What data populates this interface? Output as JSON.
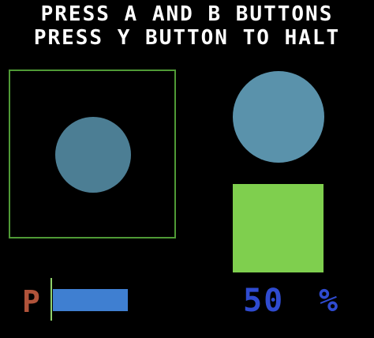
{
  "instructions": {
    "line1": "PRESS A AND B BUTTONS",
    "line2": "PRESS Y BUTTON TO HALT"
  },
  "shapes": {
    "frame_color": "#4f9a36",
    "circle_in_frame_color": "#4c7e94",
    "circle_right_color": "#5a92ab",
    "square_color": "#7fcf4e"
  },
  "progress": {
    "label": "P",
    "value_percent": 50,
    "bar_color": "#3f7fd1",
    "marker_color": "#8fd16a"
  },
  "readout": {
    "value": "50",
    "unit": "%",
    "color": "#2f4bd0"
  }
}
